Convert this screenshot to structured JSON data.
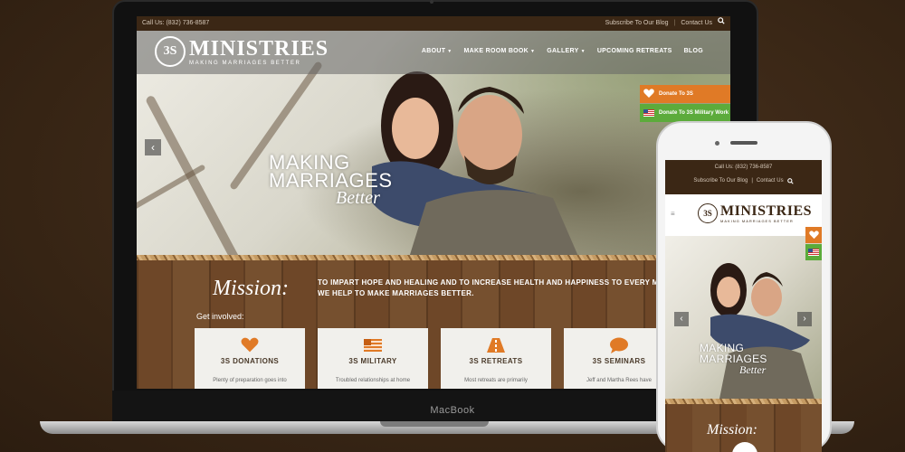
{
  "colors": {
    "brand_brown": "#3b2715",
    "accent_orange": "#e07a26",
    "accent_green": "#5cab3b"
  },
  "laptop": {
    "brand": "MacBook"
  },
  "desktop": {
    "topbar": {
      "call": "Call Us: (832) 736-8587",
      "subscribe": "Subscribe To Our Blog",
      "contact": "Contact Us",
      "separator": "|",
      "search_icon": "search-icon"
    },
    "logo": {
      "badge": "3S",
      "name": "MINISTRIES",
      "tagline": "MAKING MARRIAGES BETTER"
    },
    "nav": [
      {
        "label": "ABOUT",
        "has_dropdown": true
      },
      {
        "label": "MAKE ROOM BOOK",
        "has_dropdown": true
      },
      {
        "label": "GALLERY",
        "has_dropdown": true
      },
      {
        "label": "UPCOMING RETREATS",
        "has_dropdown": false
      },
      {
        "label": "BLOG",
        "has_dropdown": false
      }
    ],
    "donate": {
      "primary": "Donate To 3S",
      "military": "Donate To 3S Military Work"
    },
    "hero": {
      "line1": "MAKING",
      "line2": "MARRIAGES",
      "line3": "Better",
      "prev_icon": "chevron-left-icon"
    },
    "mission": {
      "title": "Mission:",
      "text": "TO IMPART HOPE AND HEALING AND TO INCREASE HEALTH AND HAPPINESS TO EVERY MARRIED COUPLE. WE HELP TO MAKE MARRIAGES BETTER."
    },
    "get_involved": "Get involved:",
    "cards": [
      {
        "title": "3S DONATIONS",
        "text": "Plenty of preparation goes into",
        "icon": "heart-icon"
      },
      {
        "title": "3S MILITARY",
        "text": "Troubled relationships at home",
        "icon": "flag-icon"
      },
      {
        "title": "3S RETREATS",
        "text": "Most retreats are primarily",
        "icon": "road-icon"
      },
      {
        "title": "3S SEMINARS",
        "text": "Jeff and Martha Rees have",
        "icon": "speech-bubble-icon"
      }
    ]
  },
  "mobile": {
    "topbar": {
      "call": "Call Us: (832) 736-8587",
      "subscribe": "Subscribe To Our Blog",
      "contact": "Contact Us",
      "separator": "|"
    },
    "menu": "≡",
    "logo": {
      "badge": "3S",
      "name": "MINISTRIES",
      "tagline": "MAKING MARRIAGES BETTER"
    },
    "hero": {
      "line1": "MAKING",
      "line2": "MARRIAGES",
      "line3": "Better"
    },
    "mission": {
      "title": "Mission:"
    }
  }
}
